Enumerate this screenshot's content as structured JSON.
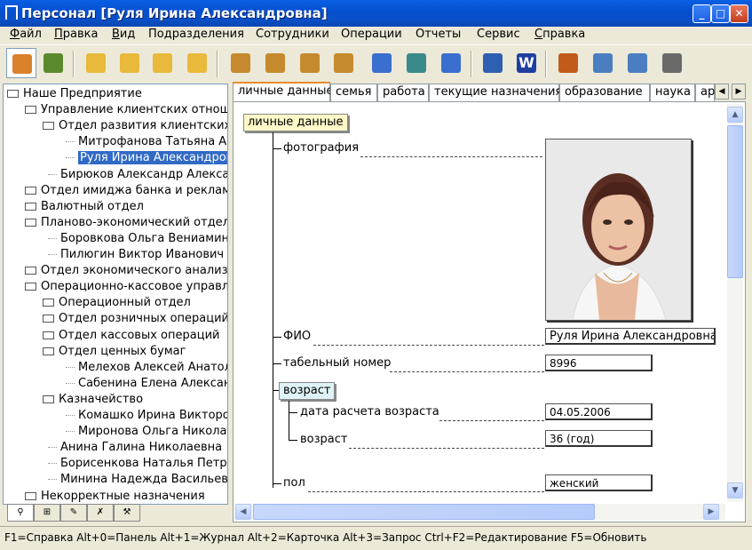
{
  "window": {
    "title": "Персонал [Руля Ирина Александровна]"
  },
  "menu": [
    {
      "label": "Файл",
      "u": "Ф",
      "rest": "айл"
    },
    {
      "label": "Правка",
      "u": "П",
      "rest": "равка"
    },
    {
      "label": "Вид",
      "u": "В",
      "rest": "ид"
    },
    {
      "label": "Подразделения",
      "u": "",
      "rest": "Подразделения"
    },
    {
      "label": "Сотрудники",
      "u": "",
      "rest": "Сотрудники"
    },
    {
      "label": "Операции",
      "u": "",
      "rest": "Операции"
    },
    {
      "label": "Отчеты",
      "u": "",
      "rest": "Отчеты"
    },
    {
      "label": "Сервис",
      "u": "",
      "rest": "Сервис"
    },
    {
      "label": "Справка",
      "u": "С",
      "rest": "правка"
    }
  ],
  "toolbar_icons": [
    "home-icon",
    "users-icon",
    "folder-add-icon",
    "folder-back-icon",
    "folder-delete-icon",
    "folder-edit-icon",
    "user-add-icon",
    "user-move-icon",
    "user-coins-icon",
    "user-delete-icon",
    "user-calendar-icon",
    "user-transfer-icon",
    "user-card-icon",
    "id-card-icon",
    "word-icon",
    "org-chart-icon",
    "form-icon",
    "calendar-icon",
    "calculator-icon"
  ],
  "tree": [
    {
      "label": "Наше Предприятие",
      "level": 0,
      "folder": true
    },
    {
      "label": "Управление клиентских отноше",
      "level": 1,
      "folder": true
    },
    {
      "label": "Отдел развития клиентских",
      "level": 2,
      "folder": true
    },
    {
      "label": "Митрофанова Татьяна А.",
      "level": 3,
      "folder": false
    },
    {
      "label": "Руля Ирина Александров",
      "level": 3,
      "folder": false,
      "selected": true
    },
    {
      "label": "Бирюков Александр Алексан",
      "level": 2,
      "folder": false
    },
    {
      "label": "Отдел имиджа банка и рекламы",
      "level": 1,
      "folder": true
    },
    {
      "label": "Валютный отдел",
      "level": 1,
      "folder": true
    },
    {
      "label": "Планово-экономический отдел",
      "level": 1,
      "folder": true
    },
    {
      "label": "Боровкова Ольга Вениамин",
      "level": 2,
      "folder": false
    },
    {
      "label": "Пилюгин Виктор Иванович",
      "level": 2,
      "folder": false
    },
    {
      "label": "Отдел экономического анализ",
      "level": 1,
      "folder": true
    },
    {
      "label": "Операционно-кассовое управл",
      "level": 1,
      "folder": true
    },
    {
      "label": "Операционный отдел",
      "level": 2,
      "folder": true
    },
    {
      "label": "Отдел розничных операций",
      "level": 2,
      "folder": true
    },
    {
      "label": "Отдел кассовых операций",
      "level": 2,
      "folder": true
    },
    {
      "label": "Отдел ценных бумаг",
      "level": 2,
      "folder": true
    },
    {
      "label": "Мелехов Алексей Анатол",
      "level": 3,
      "folder": false
    },
    {
      "label": "Сабенина Елена Алексан",
      "level": 3,
      "folder": false
    },
    {
      "label": "Казначейство",
      "level": 2,
      "folder": true
    },
    {
      "label": "Комашко Ирина Викторов",
      "level": 3,
      "folder": false
    },
    {
      "label": "Миронова Ольга Николае",
      "level": 3,
      "folder": false
    },
    {
      "label": "Анина Галина Николаевна",
      "level": 2,
      "folder": false
    },
    {
      "label": "Борисенкова Наталья Петро",
      "level": 2,
      "folder": false
    },
    {
      "label": "Минина Надежда Васильевн",
      "level": 2,
      "folder": false
    },
    {
      "label": "Некорректные назначения",
      "level": 1,
      "folder": true
    }
  ],
  "tabs": [
    "личные данные",
    "семья",
    "работа",
    "текущие назначения",
    "образование",
    "наука",
    "ар"
  ],
  "card": {
    "root": "личные данные",
    "photo_label": "фотография",
    "fio_label": "ФИО",
    "fio_value": "Руля Ирина Александровна",
    "tab_label": "табельный номер",
    "tab_value": "8996",
    "age_group": "возраст",
    "calc_date_label": "дата расчета возраста",
    "calc_date_value": "04.05.2006",
    "age_label": "возраст",
    "age_value": "36  (год)",
    "sex_label": "пол",
    "sex_value": "женский"
  },
  "status": "F1=Справка  Alt+0=Панель  Alt+1=Журнал  Alt+2=Карточка  Alt+3=Запрос  Ctrl+F2=Редактирование  F5=Обновить",
  "colors": {
    "title_bar": "#0a5fe2",
    "selection": "#316ac5",
    "node_root": "#fdf8c8",
    "node_group": "#dff3f7"
  }
}
